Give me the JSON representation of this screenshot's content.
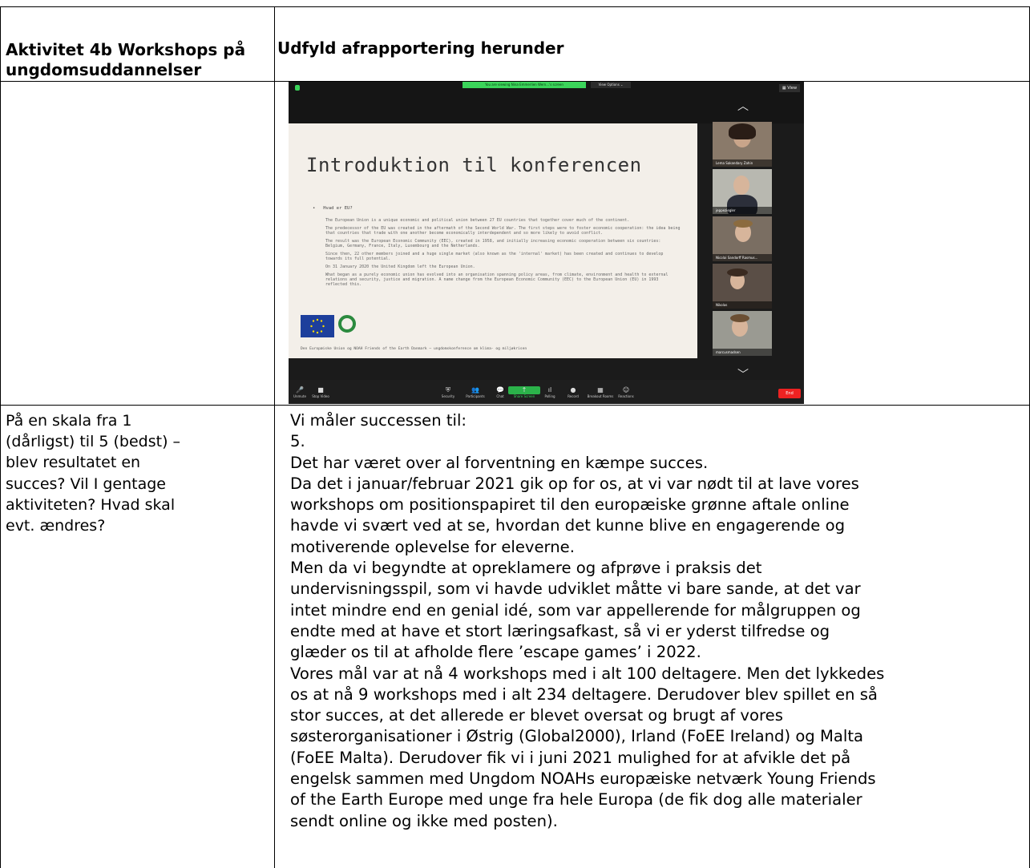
{
  "header": {
    "left": "Aktivitet 4b Workshops på ungdomsuddannelser",
    "right": "Udfyld afrapportering herunder"
  },
  "zoom": {
    "share_banner": "You are viewing Nina Emmerlien Wern...'s screen",
    "view_options": "View Options ⌄",
    "view_button": "▦ View",
    "slide": {
      "title": "Introduktion til konferencen",
      "bullet": "Hvad er EU?",
      "paragraphs": [
        "The European Union is a unique economic and political union between 27 EU countries that together cover much of the continent.",
        "The predecessor of the EU was created in the aftermath of the Second World War. The first steps were to foster economic cooperation: the idea being that countries that trade with one another become economically interdependent and so more likely to avoid conflict.",
        "The result was the European Economic Community (EEC), created in 1958, and initially increasing economic cooperation between six countries: Belgium, Germany, France, Italy, Luxembourg and the Netherlands.",
        "Since then, 22 other members joined and a huge single market (also known as the 'internal' market) has been created and continues to develop towards its full potential.",
        "On 31 January 2020 the United Kingdom left the European Union.",
        "What began as a purely economic union has evolved into an organisation spanning policy areas, from climate, environment and health to external relations and security, justice and migration. A name change from the European Economic Community (EEC) to the European Union (EU) in 1993 reflected this."
      ],
      "footer": "Den Europæiske Union og NOAH Friends of the Earth Danmark – ungdomskonference om klima- og miljøkrisen"
    },
    "participants": [
      "Lema Sakandary Zahin",
      "jeppeziegler",
      "Nicolai Sandorff Rasmus...",
      "Nikolas",
      "marcusmadsen"
    ],
    "toolbar": [
      {
        "icon": "🎤",
        "label": "Unmute"
      },
      {
        "icon": "■",
        "label": "Stop Video"
      },
      {
        "icon": "⛨",
        "label": "Security"
      },
      {
        "icon": "👥",
        "label": "Participants"
      },
      {
        "icon": "💬",
        "label": "Chat"
      },
      {
        "icon": "↑",
        "label": "Share Screen"
      },
      {
        "icon": "ıl",
        "label": "Polling"
      },
      {
        "icon": "●",
        "label": "Record"
      },
      {
        "icon": "▦",
        "label": "Breakout Rooms"
      },
      {
        "icon": "☺",
        "label": "Reactions"
      }
    ],
    "end_label": "End"
  },
  "question": {
    "lines": [
      "På en skala fra 1",
      "(dårligst) til 5 (bedst) –",
      "blev resultatet en",
      "succes? Vil I gentage",
      "aktiviteten? Hvad skal",
      "evt. ændres?"
    ]
  },
  "answer": {
    "lines": [
      "Vi måler successen til:",
      "5.",
      "Det har været over al forventning en kæmpe succes.",
      "Da det i januar/februar 2021 gik op for os, at vi var nødt til at lave vores",
      "workshops om positionspapiret til den europæiske grønne aftale online",
      "havde vi svært ved at se, hvordan det kunne blive en engagerende og",
      "motiverende oplevelse for eleverne.",
      "Men da vi begyndte at opreklamere og afprøve i praksis det",
      "undervisningsspil, som vi havde udviklet måtte vi bare sande, at det var",
      "intet mindre end en genial idé, som var appellerende for målgruppen og",
      "endte med at have et stort læringsafkast, så vi er yderst tilfredse og",
      "glæder os til at afholde flere ’escape games’ i 2022.",
      "Vores mål var at nå 4 workshops med i alt 100 deltagere. Men det lykkedes",
      "os at nå 9 workshops med i alt 234 deltagere. Derudover blev spillet en så",
      "stor succes, at det allerede er blevet oversat og brugt af vores",
      "søsterorganisationer i Østrig (Global2000), Irland (FoEE Ireland) og Malta",
      "(FoEE Malta). Derudover fik vi i juni 2021 mulighed for at afvikle det på",
      "engelsk sammen med Ungdom NOAHs europæiske netværk Young Friends",
      "of the Earth Europe med unge fra hele Europa (de fik dog alle materialer",
      "sendt online og ikke med posten)."
    ]
  }
}
